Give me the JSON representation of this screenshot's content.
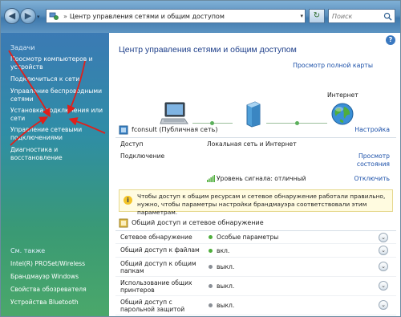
{
  "window": {
    "breadcrumb_sep": "»",
    "address_path": "Центр управления сетями и общим доступом",
    "search_placeholder": "Поиск",
    "back_glyph": "◀",
    "forward_glyph": "▶",
    "refresh_glyph": "↻",
    "help_glyph": "?"
  },
  "sidebar": {
    "heading": "Задачи",
    "tasks": [
      "Просмотр компьютеров и устройств",
      "Подключиться к сети",
      "Управление беспроводными сетями",
      "Установка подключения или сети",
      "Управление сетевыми подключениями",
      "Диагностика и восстановление"
    ],
    "see_also_heading": "См. также",
    "see_also": [
      "Intel(R) PROSet/Wireless",
      "Брандмауэр Windows",
      "Свойства обозревателя",
      "Устройства Bluetooth"
    ]
  },
  "main": {
    "title": "Центр управления сетями и общим доступом",
    "full_map_link": "Просмотр полной карты",
    "map_internet_label": "Интернет",
    "network": {
      "name": "fconsult (Публичная сеть)",
      "customize_link": "Настройка",
      "rows": [
        {
          "key": "Доступ",
          "value": "Локальная сеть и Интернет",
          "link": ""
        },
        {
          "key": "Подключение",
          "value": "",
          "link": "Просмотр состояния"
        },
        {
          "key": "",
          "value": "Уровень сигнала: отличный",
          "link": "Отключить"
        }
      ]
    },
    "info_text": "Чтобы доступ к общим ресурсам и сетевое обнаружение работали правильно, нужно, чтобы параметры настройки брандмауэра соответствовали этим параметрам.",
    "sharing": {
      "title": "Общий доступ и сетевое обнаружение",
      "rows": [
        {
          "key": "Сетевое обнаружение",
          "value": "Особые параметры",
          "status": "on"
        },
        {
          "key": "Общий доступ к файлам",
          "value": "вкл.",
          "status": "on"
        },
        {
          "key": "Общий доступ к общим папкам",
          "value": "выкл.",
          "status": "off"
        },
        {
          "key": "Использование общих принтеров",
          "value": "выкл.",
          "status": "off"
        },
        {
          "key": "Общий доступ с парольной защитой",
          "value": "выкл.",
          "status": "off"
        }
      ],
      "expander_glyph": "⌄"
    }
  },
  "colors": {
    "status_on": "#4fae3c",
    "status_off": "#8a8f96",
    "annotation_arrow": "#e0201b"
  }
}
